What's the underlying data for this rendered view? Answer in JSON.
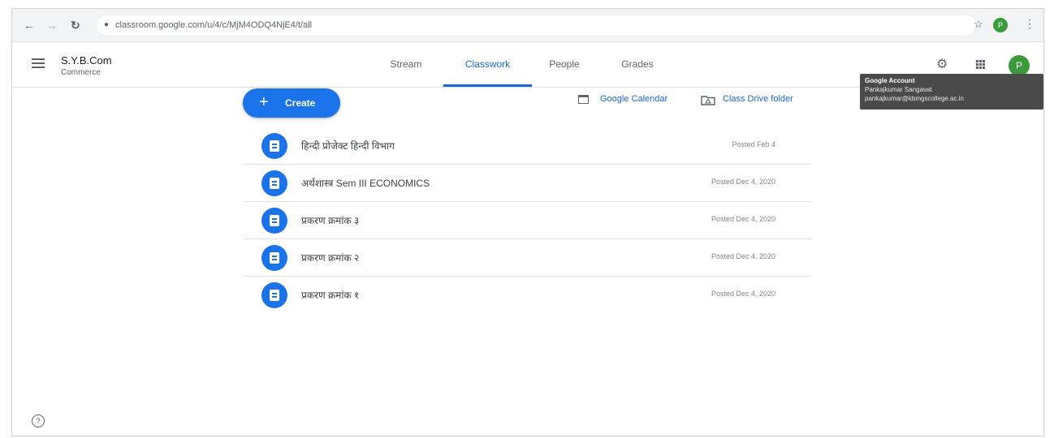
{
  "browser": {
    "url": "classroom.google.com/u/4/c/MjM4ODQ4NjE4/t/all",
    "avatar_letter": "P"
  },
  "header": {
    "class_name": "S.Y.B.Com",
    "class_section": "Commerce",
    "tabs": [
      {
        "label": "Stream",
        "active": false
      },
      {
        "label": "Classwork",
        "active": true
      },
      {
        "label": "People",
        "active": false
      },
      {
        "label": "Grades",
        "active": false
      }
    ],
    "avatar_letter": "P"
  },
  "tooltip": {
    "title": "Google Account",
    "name": "Pankajkumar Sangavat",
    "email": "pankajkumar@kbmgscollege.ac.in"
  },
  "toolbar": {
    "create_label": "Create",
    "calendar_label": "Google Calendar",
    "drive_label": "Class Drive folder"
  },
  "topics": [
    {
      "title": "हिन्दी प्रोजेक्ट हिन्दी विभाग",
      "date": "Posted Feb 4"
    },
    {
      "title": "अर्थशास्त्र Sem III ECONOMICS",
      "date": "Posted Dec 4, 2020"
    },
    {
      "title": "प्रकरण क्रमांक ३",
      "date": "Posted Dec 4, 2020"
    },
    {
      "title": "प्रकरण क्रमांक २",
      "date": "Posted Dec 4, 2020"
    },
    {
      "title": "प्रकरण क्रमांक १",
      "date": "Posted Dec 4, 2020"
    }
  ],
  "icons": {
    "back": "arrow-back-icon",
    "forward": "arrow-forward-icon",
    "reload": "reload-icon",
    "menu": "hamburger-menu-icon",
    "settings": "gear-icon",
    "apps": "apps-grid-icon",
    "help": "help-icon",
    "topic": "assignment-icon"
  },
  "colors": {
    "accent": "#1a73e8",
    "active_tab": "#1967d2",
    "avatar": "#3c9a3c"
  }
}
